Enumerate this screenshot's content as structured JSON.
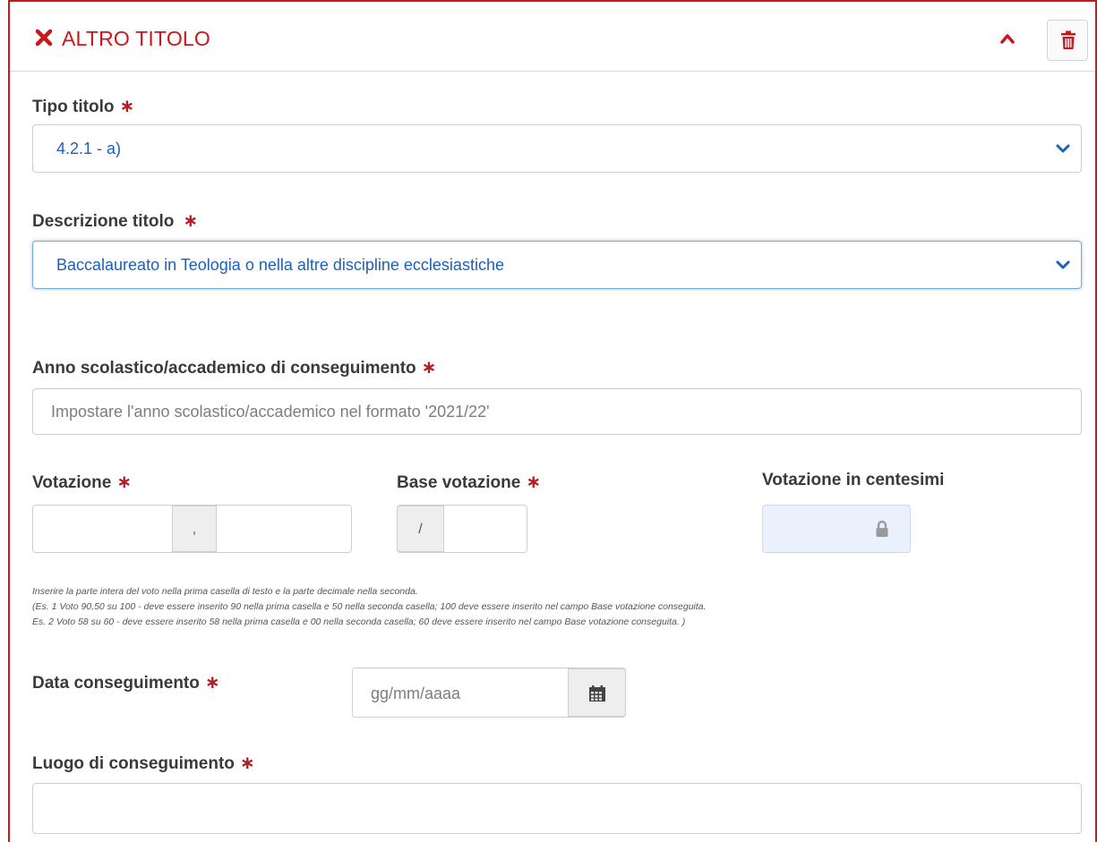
{
  "panel": {
    "title": "ALTRO TITOLO",
    "close_icon": "close-x-icon",
    "collapse_icon": "chevron-up-icon",
    "delete_icon": "trash-icon",
    "accent_color": "#c9171d"
  },
  "fields": {
    "tipo_titolo": {
      "label": "Tipo titolo",
      "required_mark": "∗",
      "value": "4.2.1 - a)"
    },
    "descrizione_titolo": {
      "label": "Descrizione titolo",
      "required_mark": "∗",
      "value": "Baccalaureato in Teologia o nella altre discipline ecclesiastiche"
    },
    "anno": {
      "label": "Anno scolastico/accademico di conseguimento",
      "required_mark": "∗",
      "placeholder": "Impostare l'anno scolastico/accademico nel formato '2021/22'"
    },
    "votazione": {
      "label": "Votazione",
      "required_mark": "∗",
      "separator": ","
    },
    "base_votazione": {
      "label": "Base votazione",
      "required_mark": "∗",
      "separator": "/"
    },
    "votazione_centesimi": {
      "label": "Votazione in centesimi",
      "lock_icon": "lock-icon"
    },
    "hint_lines": [
      "Inserire la parte intera del voto nella prima casella di testo e la parte decimale nella seconda.",
      "(Es. 1 Voto 90,50 su 100 - deve essere inserito 90 nella prima casella e 50 nella seconda casella; 100 deve essere inserito nel campo Base votazione conseguita.",
      " Es. 2 Voto 58 su 60 - deve essere inserito 58 nella prima casella e 00 nella seconda casella; 60 deve essere inserito nel campo Base votazione conseguita. )"
    ],
    "data_conseguimento": {
      "label": "Data conseguimento",
      "required_mark": "∗",
      "placeholder": "gg/mm/aaaa",
      "calendar_icon": "calendar-icon"
    },
    "luogo_conseguimento": {
      "label": "Luogo di conseguimento",
      "required_mark": "∗"
    }
  }
}
